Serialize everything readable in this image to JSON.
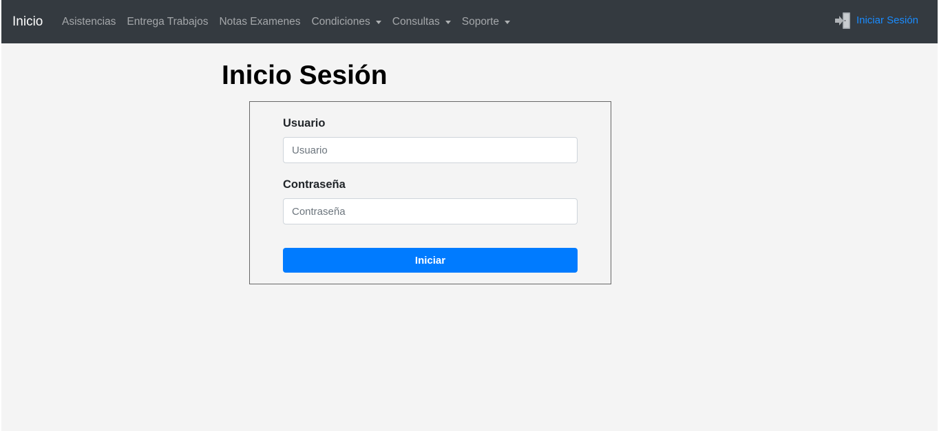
{
  "navbar": {
    "brand": "Inicio",
    "links": [
      {
        "label": "Asistencias"
      },
      {
        "label": "Entrega Trabajos"
      },
      {
        "label": "Notas Examenes"
      },
      {
        "label": "Condiciones"
      },
      {
        "label": "Consultas"
      },
      {
        "label": "Soporte"
      }
    ],
    "login": {
      "label": "Iniciar Sesión",
      "icon": "door-enter-icon"
    }
  },
  "page": {
    "title": "Inicio Sesión"
  },
  "form": {
    "username_label": "Usuario",
    "username_placeholder": "Usuario",
    "username_value": "",
    "password_label": "Contraseña",
    "password_placeholder": "Contraseña",
    "password_value": "",
    "submit_label": "Iniciar"
  },
  "colors": {
    "navbar_bg": "#343a40",
    "page_bg": "#f4f4f4",
    "primary": "#007bff",
    "login_link": "#1a8cff"
  }
}
